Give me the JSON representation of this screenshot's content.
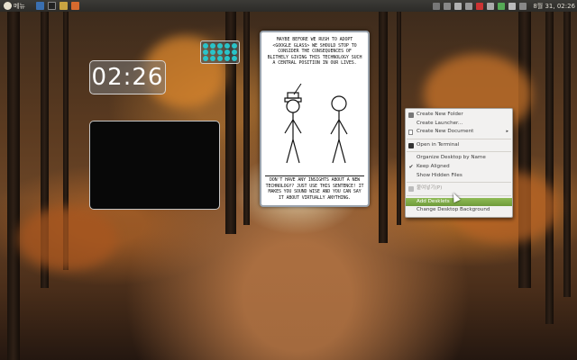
{
  "panel": {
    "menu_label": "메뉴",
    "clock_text": "8월 31, 02:26"
  },
  "clock_desklet": {
    "time": "02:26"
  },
  "comic": {
    "top_text": "MAYBE BEFORE WE RUSH TO ADOPT <GOOGLE GLASS> WE SHOULD STOP TO CONSIDER THE CONSEQUENCES OF BLITHELY GIVING THIS TECHNOLOGY SUCH A CENTRAL POSITION IN OUR LIVES.",
    "bottom_text": "DON'T HAVE ANY INSIGHTS ABOUT A NEW TECHNOLOGY? JUST USE THIS SENTENCE! IT MAKES YOU SOUND WISE AND YOU CAN SAY IT ABOUT VIRTUALLY ANYTHING."
  },
  "context_menu": {
    "items": [
      {
        "label": "Create New Folder",
        "icon": "folder-icon"
      },
      {
        "label": "Create Launcher...",
        "icon": ""
      },
      {
        "label": "Create New Document",
        "icon": "document-icon",
        "submenu": true
      },
      {
        "label": "Open in Terminal",
        "icon": "terminal-icon"
      },
      {
        "label": "Organize Desktop by Name",
        "icon": ""
      },
      {
        "label": "Keep Aligned",
        "icon": "check-icon"
      },
      {
        "label": "Show Hidden Files",
        "icon": ""
      },
      {
        "label": "붙여넣기(P)",
        "icon": "paste-icon",
        "disabled": true
      },
      {
        "label": "Add Desklets",
        "icon": "",
        "highlighted": true
      },
      {
        "label": "Change Desktop Background",
        "icon": ""
      }
    ]
  },
  "colors": {
    "panel_bg": "#3c3b37",
    "menu_highlight": "#7aa843",
    "desklet_dots": "#29c3c9"
  }
}
